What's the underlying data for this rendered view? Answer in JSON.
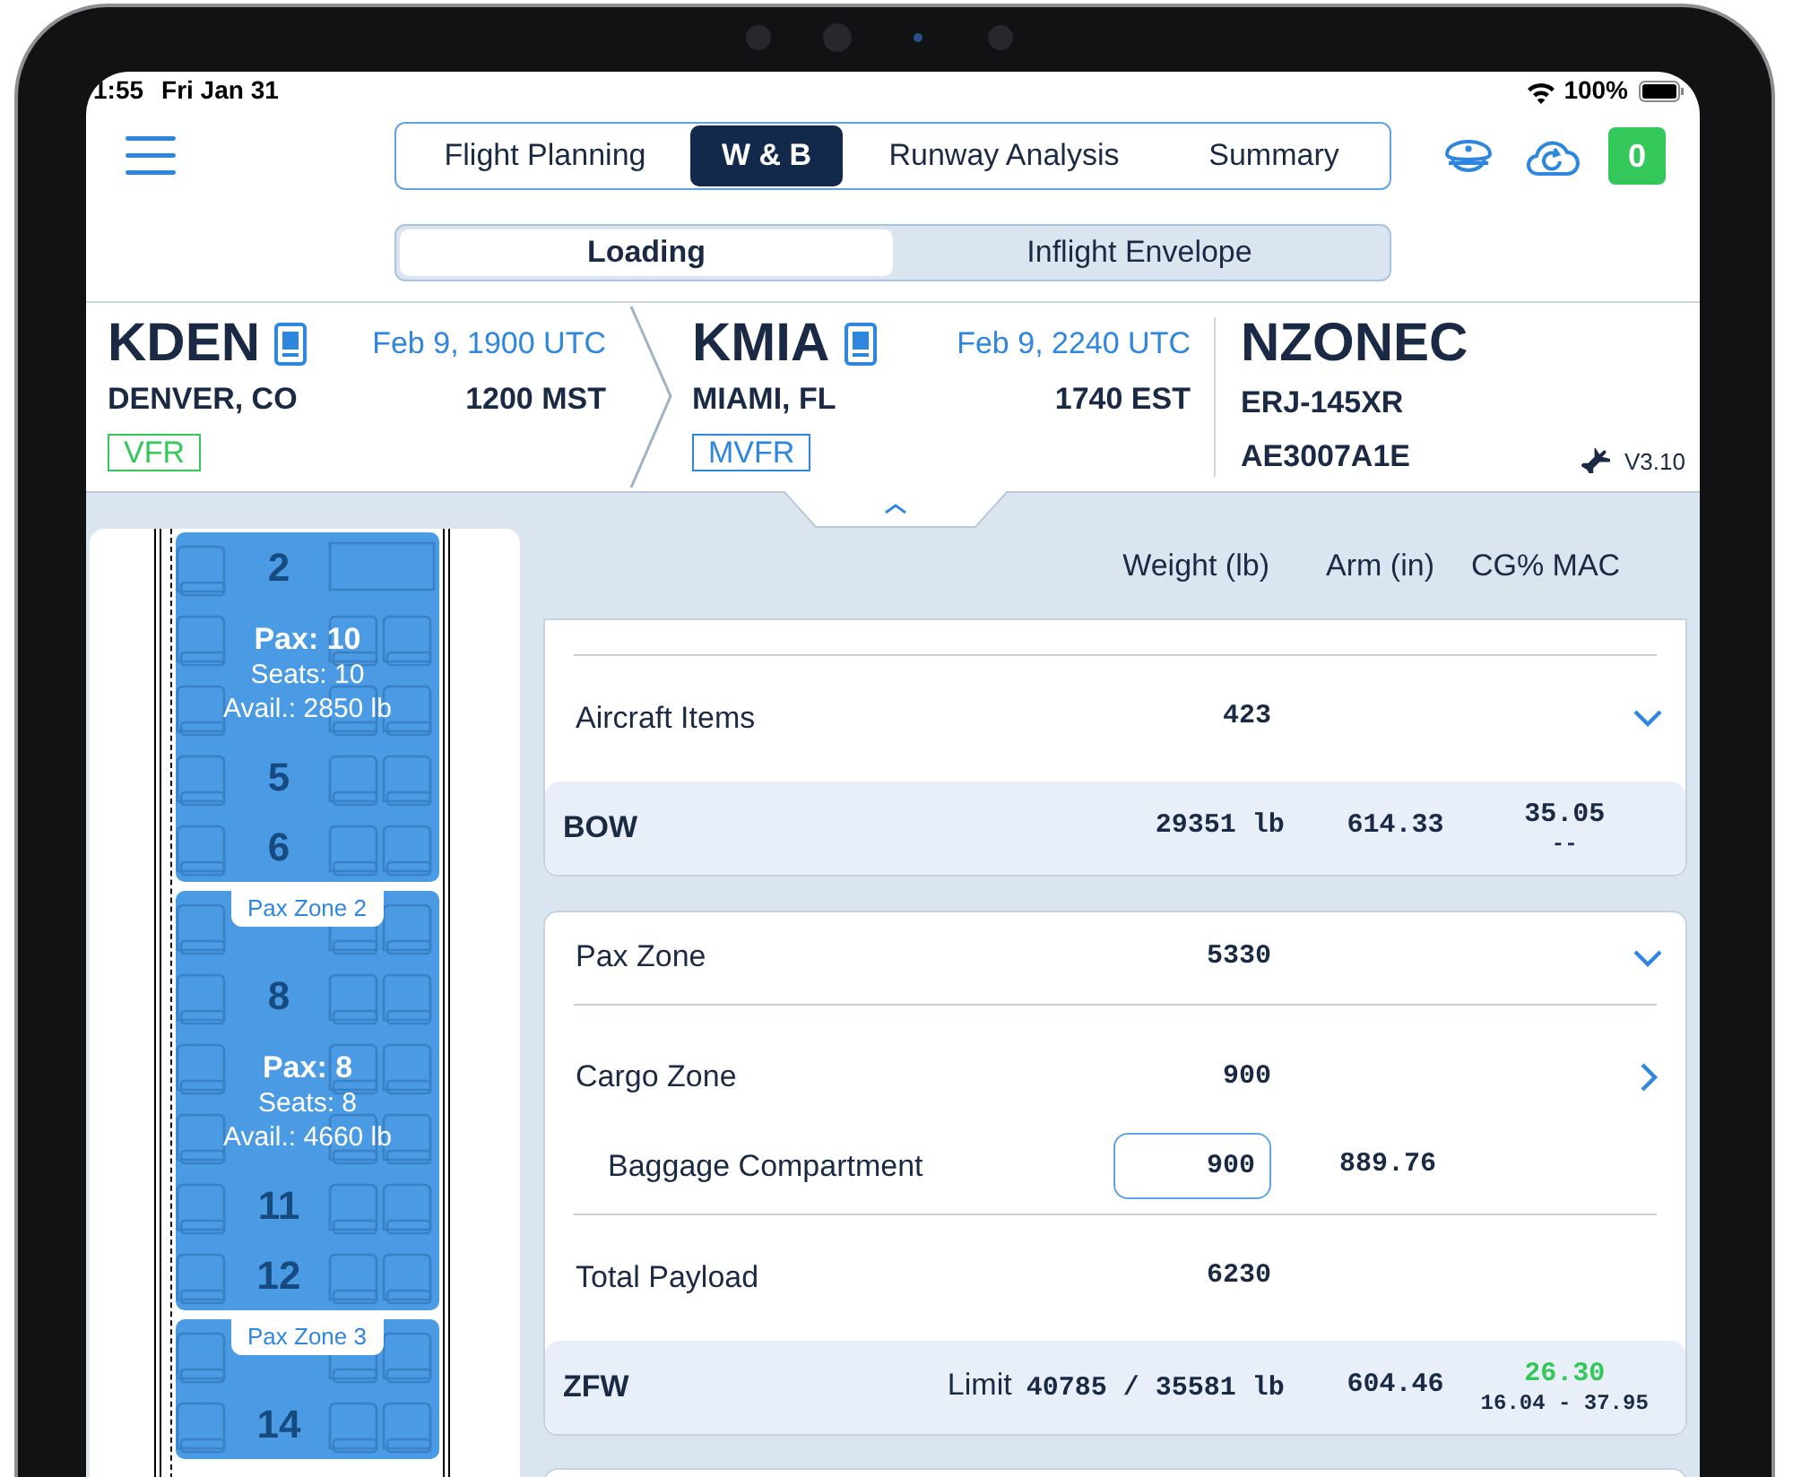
{
  "status_bar": {
    "time": "1:55",
    "date": "Fri Jan 31",
    "battery": "100%"
  },
  "tabs": [
    {
      "label": "Flight Planning",
      "selected": false
    },
    {
      "label": "W & B",
      "selected": true
    },
    {
      "label": "Runway Analysis",
      "selected": false
    },
    {
      "label": "Summary",
      "selected": false
    }
  ],
  "notification_count": "0",
  "subtabs": [
    {
      "label": "Loading",
      "selected": true
    },
    {
      "label": "Inflight Envelope",
      "selected": false
    }
  ],
  "route": [
    {
      "code": "KDEN",
      "time_utc": "Feb 9, 1900 UTC",
      "city": "DENVER, CO",
      "time_local": "1200 MST",
      "flight_rules": "VFR",
      "color": "#34c759"
    },
    {
      "code": "KMIA",
      "time_utc": "Feb 9, 2240 UTC",
      "city": "MIAMI, FL",
      "time_local": "1740 EST",
      "flight_rules": "MVFR",
      "color": "#2f86de"
    }
  ],
  "aircraft": {
    "registration": "NZONEC",
    "type": "ERJ-145XR",
    "serial": "AE3007A1E",
    "version": "V3.10"
  },
  "seat_map": {
    "zones": [
      {
        "pax": "Pax: 10",
        "seats": "Seats: 10",
        "available": "Avail.: 2850 lb",
        "rows": [
          {
            "number": "2",
            "kind": "galley"
          },
          {
            "kind": "seats"
          },
          {
            "kind": "seats"
          },
          {
            "number": "5",
            "kind": "seats"
          },
          {
            "number": "6",
            "kind": "seats"
          }
        ]
      },
      {
        "label": "Pax Zone 2",
        "pax": "Pax: 8",
        "seats": "Seats: 8",
        "available": "Avail.: 4660 lb",
        "rows": [
          {
            "kind": "seats"
          },
          {
            "number": "8",
            "kind": "seats"
          },
          {
            "kind": "seats"
          },
          {
            "kind": "seats"
          },
          {
            "number": "11",
            "kind": "seats"
          },
          {
            "number": "12",
            "kind": "seats"
          }
        ]
      },
      {
        "label": "Pax Zone 3",
        "rows": [
          {
            "kind": "seats"
          },
          {
            "number": "14",
            "kind": "seats"
          }
        ]
      }
    ]
  },
  "columns": [
    "Weight (lb)",
    "Arm (in)",
    "CG% MAC"
  ],
  "sections": [
    {
      "rows": [
        {
          "kind": "item",
          "label": "Aircraft Items",
          "weight": "423",
          "expanded": true
        }
      ],
      "summary": {
        "label": "BOW",
        "weight": "29351 lb",
        "arm": "614.33",
        "cg": "35.05",
        "cg_range": "--"
      }
    },
    {
      "rows": [
        {
          "kind": "item",
          "label": "Pax Zone",
          "weight": "5330",
          "expanded": true,
          "divider": true
        },
        {
          "kind": "item",
          "label": "Cargo Zone",
          "weight": "900",
          "expanded": false
        },
        {
          "kind": "input",
          "label": "Baggage Compartment",
          "value": "900",
          "arm": "889.76",
          "divider": true
        },
        {
          "kind": "item",
          "label": "Total Payload",
          "weight": "6230"
        }
      ],
      "summary": {
        "label": "ZFW",
        "weight_prefix": "Limit",
        "weight": "40785 / 35581 lb",
        "arm": "604.46",
        "cg": "26.30",
        "cg_range": "16.04 - 37.95",
        "cg_in_limits": true
      }
    }
  ]
}
